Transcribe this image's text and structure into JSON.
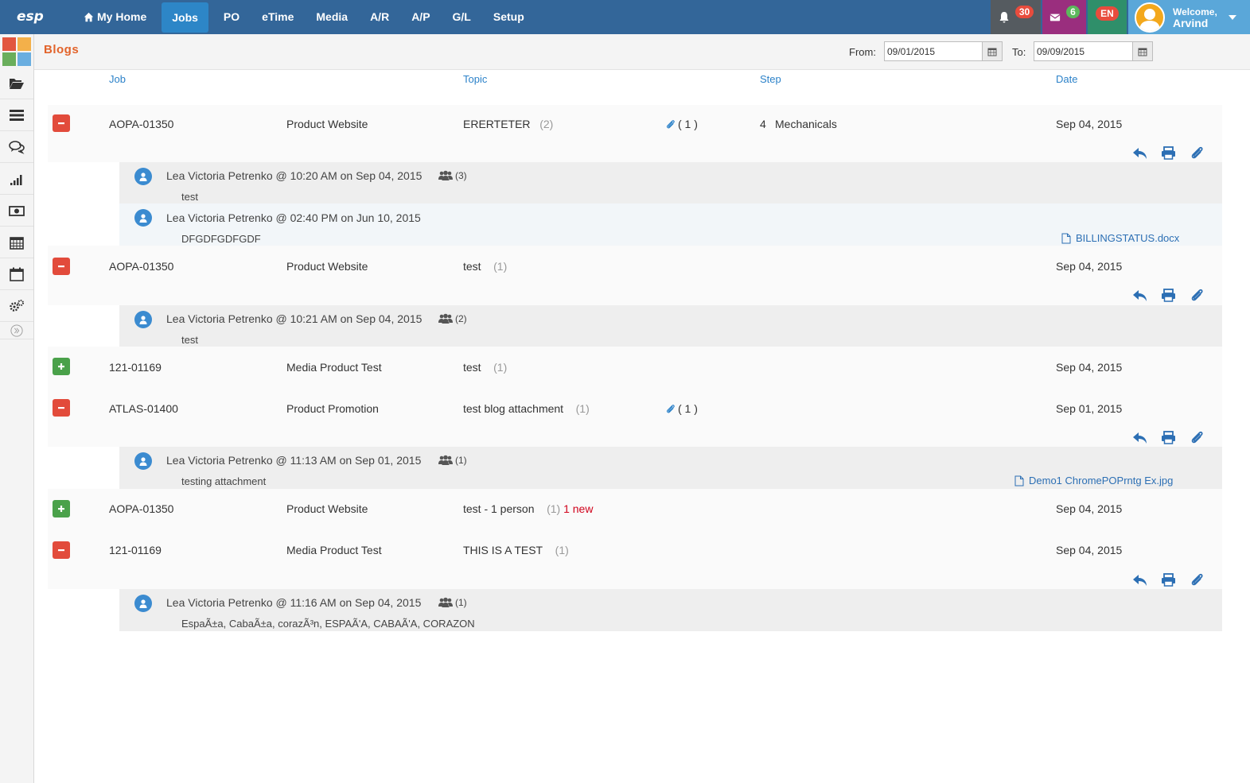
{
  "app": {
    "logo": "esp"
  },
  "nav": {
    "items": [
      {
        "label": "My Home",
        "icon": "home-icon"
      },
      {
        "label": "Jobs",
        "active": true
      },
      {
        "label": "PO"
      },
      {
        "label": "eTime"
      },
      {
        "label": "Media"
      },
      {
        "label": "A/R"
      },
      {
        "label": "A/P"
      },
      {
        "label": "G/L"
      },
      {
        "label": "Setup"
      }
    ],
    "notifications": "30",
    "messages": "6",
    "language": "EN",
    "welcome": "Welcome,",
    "user": "Arvind"
  },
  "sidebar": {
    "items": [
      "folder-open-icon",
      "list-icon",
      "comments-icon",
      "signal-icon",
      "money-icon",
      "calendar-grid-icon",
      "calendar-icon",
      "cogs-icon",
      "expand-icon"
    ]
  },
  "page": {
    "title": "Blogs",
    "from_label": "From:",
    "from_value": "09/01/2015",
    "to_label": "To:",
    "to_value": "09/09/2015"
  },
  "columns": {
    "job": "Job",
    "topic": "Topic",
    "step": "Step",
    "date": "Date"
  },
  "rows": [
    {
      "state": "expanded",
      "job": "AOPA-01350",
      "desc": "Product Website",
      "topic": "ERERTETER",
      "count": "(2)",
      "attachments": "( 1 )",
      "step_no": "4",
      "step": "Mechanicals",
      "date": "Sep 04, 2015",
      "posts": [
        {
          "head": "Lea Victoria Petrenko @ 10:20 AM on Sep 04, 2015",
          "group": "(3)",
          "body": "test"
        },
        {
          "head": "Lea Victoria Petrenko @ 02:40 PM on Jun 10, 2015",
          "body": "DFGDFGDFGDF",
          "file": "BILLINGSTATUS.docx"
        }
      ]
    },
    {
      "state": "expanded",
      "job": "AOPA-01350",
      "desc": "Product Website",
      "topic": "test",
      "count": "(1)",
      "date": "Sep 04, 2015",
      "posts": [
        {
          "head": "Lea Victoria Petrenko @ 10:21 AM on Sep 04, 2015",
          "group": "(2)",
          "body": "test"
        }
      ]
    },
    {
      "state": "collapsed",
      "job": "121-01169",
      "desc": "Media Product Test",
      "topic": "test",
      "count": "(1)",
      "date": "Sep 04, 2015"
    },
    {
      "state": "expanded",
      "job": "ATLAS-01400",
      "desc": "Product Promotion",
      "topic": "test blog attachment",
      "count": "(1)",
      "attachments": "( 1 )",
      "date": "Sep 01, 2015",
      "posts": [
        {
          "head": "Lea Victoria Petrenko @ 11:13 AM on Sep 01, 2015",
          "group": "(1)",
          "body": "testing attachment",
          "file": "Demo1 ChromePOPrntg Ex.jpg"
        }
      ]
    },
    {
      "state": "collapsed",
      "job": "AOPA-01350",
      "desc": "Product Website",
      "topic": "test - 1 person",
      "count": "(1)",
      "new": "1 new",
      "date": "Sep 04, 2015"
    },
    {
      "state": "expanded",
      "job": "121-01169",
      "desc": "Media Product Test",
      "topic": "THIS IS A TEST",
      "count": "(1)",
      "date": "Sep 04, 2015",
      "posts": [
        {
          "head": "Lea Victoria Petrenko @ 11:16 AM on Sep 04, 2015",
          "group": "(1)",
          "body": "EspaÃ±a, CabaÃ±a, corazÃ³n, ESPAÃ'A, CABAÃ'A, CORAZON"
        }
      ]
    }
  ]
}
